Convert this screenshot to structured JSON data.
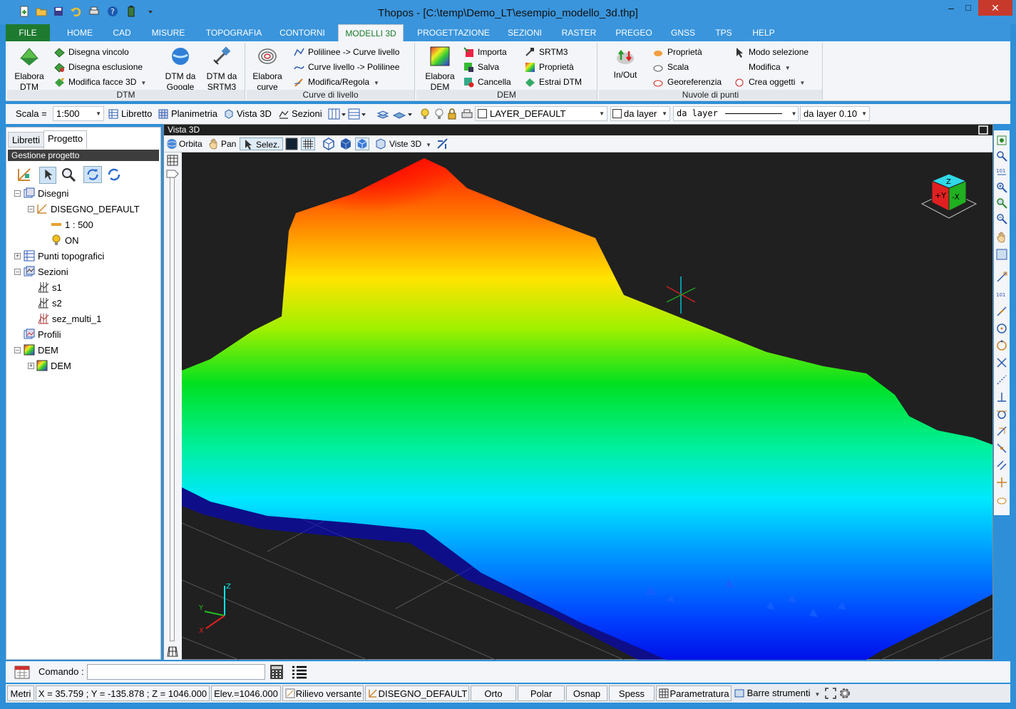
{
  "window": {
    "title": "Thopos - [C:\\temp\\Demo_LT\\esempio_modello_3d.thp]",
    "minimize": "–",
    "maximize": "□",
    "close": "✕"
  },
  "ribbon_tabs": [
    "FILE",
    "HOME",
    "CAD",
    "MISURE",
    "TOPOGRAFIA",
    "CONTORNI",
    "MODELLI 3D",
    "PROGETTAZIONE",
    "SEZIONI",
    "RASTER",
    "PREGEO",
    "GNSS",
    "TPS",
    "HELP"
  ],
  "ribbon": {
    "dtm": {
      "label": "DTM",
      "elabora_dtm": "Elabora DTM",
      "disegna_vincolo": "Disegna vincolo",
      "disegna_esclusione": "Disegna esclusione",
      "modifica_facce": "Modifica facce 3D",
      "dtm_google": "DTM da Google",
      "dtm_srtm3": "DTM da SRTM3"
    },
    "curve": {
      "label": "Curve di livello",
      "elabora_curve": "Elabora curve",
      "poly_to_curve": "Polilinee -> Curve livello",
      "curve_to_poly": "Curve livello -> Polilinee",
      "modifica_regola": "Modifica/Regola"
    },
    "dem": {
      "label": "DEM",
      "elabora_dem": "Elabora DEM",
      "importa": "Importa",
      "salva": "Salva",
      "cancella": "Cancella",
      "srtm3": "SRTM3",
      "proprieta": "Proprietà",
      "estrai_dtm": "Estrai DTM"
    },
    "nuvole": {
      "label": "Nuvole di punti",
      "in_out": "In/Out",
      "proprieta": "Proprietà",
      "scala": "Scala",
      "georeferenzia": "Georeferenzia",
      "modo_selezione": "Modo selezione",
      "modifica": "Modifica",
      "crea_oggetti": "Crea oggetti"
    }
  },
  "toolbar": {
    "scala_label": "Scala =",
    "scala_value": "1:500",
    "libretto": "Libretto",
    "planimetria": "Planimetria",
    "vista3d": "Vista 3D",
    "sezioni": "Sezioni",
    "layer": "LAYER_DEFAULT",
    "color": "da layer",
    "linetype": "da layer",
    "lineweight": "da layer 0.10"
  },
  "left_panel": {
    "tab_libretti": "Libretti",
    "tab_progetto": "Progetto",
    "header": "Gestione progetto",
    "tree": {
      "disegni": "Disegni",
      "disegno_default": "DISEGNO_DEFAULT",
      "scale": "1 : 500",
      "on": "ON",
      "punti": "Punti topografici",
      "sezioni": "Sezioni",
      "s1": "s1",
      "s2": "s2",
      "sez_multi": "sez_multi_1",
      "profili": "Profili",
      "dem_group": "DEM",
      "dem_item": "DEM"
    }
  },
  "viewport": {
    "title": "Vista 3D",
    "orbita": "Orbita",
    "pan": "Pan",
    "selez": "Selez.",
    "viste3d": "Viste 3D",
    "axis_z": "Z",
    "axis_y": "Y",
    "axis_x": "X",
    "cube_z": "Z",
    "cube_y": "+Y",
    "cube_x": "-X"
  },
  "command": {
    "label": "Comando :",
    "value": ""
  },
  "statusbar": {
    "units": "Metri",
    "coords": "X = 35.759 ; Y = -135.878 ; Z = 1046.000",
    "elev": "Elev.=1046.000",
    "rilievo": "Rilievo versante",
    "disegno": "DISEGNO_DEFAULT",
    "orto": "Orto",
    "polar": "Polar",
    "osnap": "Osnap",
    "spess": "Spess",
    "parametratura": "Parametratura",
    "barre": "Barre strumenti"
  }
}
